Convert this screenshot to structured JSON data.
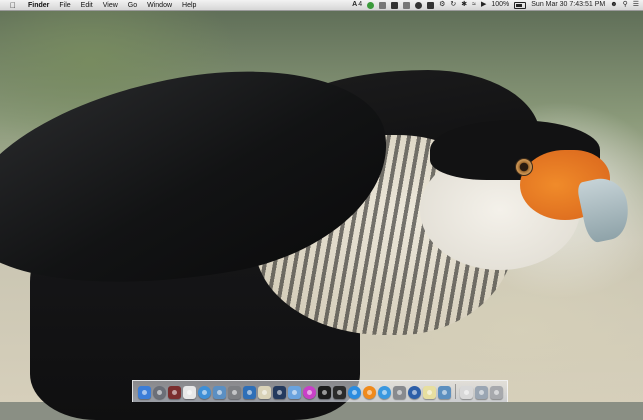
{
  "menubar": {
    "apple_icon": "apple-icon",
    "app_name": "Finder",
    "menus": [
      "File",
      "Edit",
      "View",
      "Go",
      "Window",
      "Help"
    ],
    "status": {
      "adobe_badge": "4",
      "battery_percent": "100%",
      "datetime": "Sun Mar 30  7:43:51 PM"
    }
  },
  "dock": {
    "items": [
      {
        "name": "finder",
        "icon": "finder-icon",
        "color": "#3b7dd8"
      },
      {
        "name": "launchpad",
        "icon": "launchpad-icon",
        "color": "#6b6f78"
      },
      {
        "name": "photo-booth",
        "icon": "photo-booth-icon",
        "color": "#7a2d2d"
      },
      {
        "name": "calendar",
        "icon": "calendar-icon",
        "color": "#e8e8e8"
      },
      {
        "name": "safari",
        "icon": "safari-icon",
        "color": "#3e8fd6"
      },
      {
        "name": "preview",
        "icon": "preview-icon",
        "color": "#5b8fc2"
      },
      {
        "name": "system-preferences",
        "icon": "gear-icon",
        "color": "#7d7f83"
      },
      {
        "name": "xcode",
        "icon": "xcode-icon",
        "color": "#2f6fb7"
      },
      {
        "name": "text-edit",
        "icon": "textedit-icon",
        "color": "#d9d2b8"
      },
      {
        "name": "photoshop",
        "icon": "photoshop-icon",
        "color": "#243a5e"
      },
      {
        "name": "folder",
        "icon": "folder-icon",
        "color": "#6aa3de"
      },
      {
        "name": "itunes",
        "icon": "itunes-icon",
        "color": "#c940c8"
      },
      {
        "name": "terminal",
        "icon": "terminal-icon",
        "color": "#1b1b1b"
      },
      {
        "name": "ical",
        "icon": "clock-icon",
        "color": "#2b2b2b"
      },
      {
        "name": "app-store",
        "icon": "app-store-icon",
        "color": "#2c8ce0"
      },
      {
        "name": "vlc",
        "icon": "vlc-icon",
        "color": "#f08a1c"
      },
      {
        "name": "maps",
        "icon": "globe-icon",
        "color": "#3a98e0"
      },
      {
        "name": "keychain",
        "icon": "keychain-icon",
        "color": "#888a8e"
      },
      {
        "name": "info",
        "icon": "info-icon",
        "color": "#2d5fa8"
      },
      {
        "name": "notes",
        "icon": "notes-icon",
        "color": "#e7dfa0"
      },
      {
        "name": "network",
        "icon": "network-icon",
        "color": "#5c8fbf"
      },
      {
        "name": "documents",
        "icon": "document-icon",
        "color": "#d8d8d8"
      },
      {
        "name": "downloads",
        "icon": "downloads-icon",
        "color": "#9aa6b3"
      },
      {
        "name": "trash",
        "icon": "trash-icon",
        "color": "#a7a9ad"
      }
    ]
  }
}
